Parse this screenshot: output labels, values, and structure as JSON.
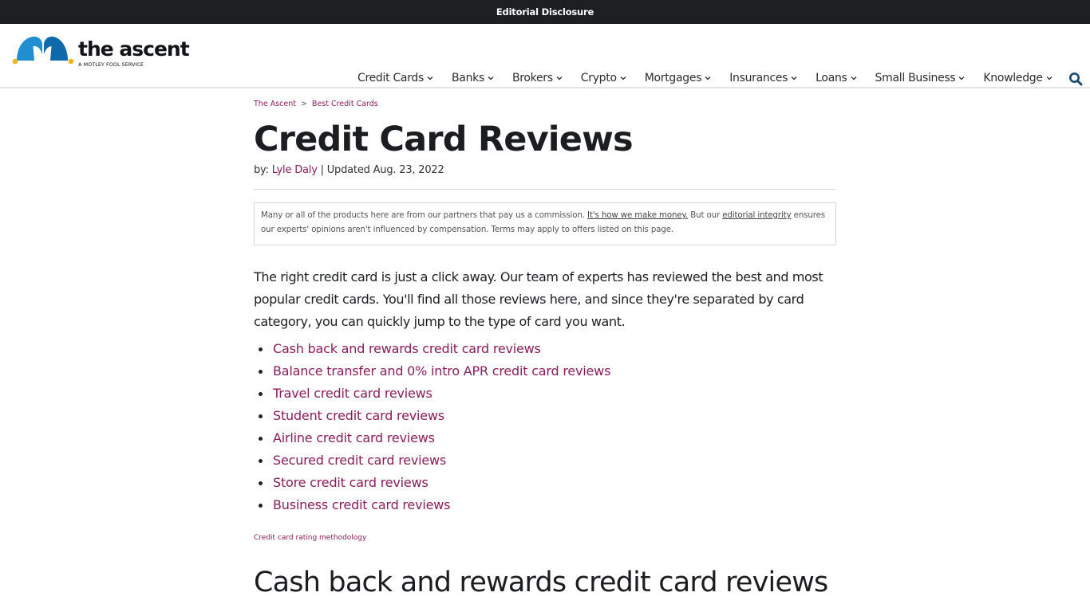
{
  "topbar": {
    "label": "Editorial Disclosure"
  },
  "brand": {
    "name": "the ascent",
    "tagline": "A MOTLEY FOOL SERVICE",
    "colors": {
      "hat_left": "#1f8fd0",
      "hat_right": "#0e6aaa",
      "bells": "#f3b31b",
      "accent": "#8b1c5c",
      "nav_icon": "#1c4a6e"
    }
  },
  "nav": {
    "items": [
      {
        "label": "Credit Cards",
        "icon": "chevron-down-icon"
      },
      {
        "label": "Banks",
        "icon": "chevron-down-icon"
      },
      {
        "label": "Brokers",
        "icon": "chevron-down-icon"
      },
      {
        "label": "Crypto",
        "icon": "chevron-down-icon"
      },
      {
        "label": "Mortgages",
        "icon": "chevron-down-icon"
      },
      {
        "label": "Insurances",
        "icon": "chevron-down-icon"
      },
      {
        "label": "Loans",
        "icon": "chevron-down-icon"
      },
      {
        "label": "Small Business",
        "icon": "chevron-down-icon"
      },
      {
        "label": "Knowledge",
        "icon": "chevron-down-icon"
      }
    ],
    "search_icon": "search-icon"
  },
  "breadcrumb": {
    "items": [
      {
        "label": "The Ascent"
      },
      {
        "label": "Best Credit Cards"
      }
    ],
    "separator": ">"
  },
  "article": {
    "title": "Credit Card Reviews",
    "byline_prefix": "by: ",
    "author": "Lyle Daly",
    "updated": " | Updated Aug. 23, 2022",
    "disclosure": {
      "text1": "Many or all of the products here are from our partners that pay us a commission. ",
      "link1": "It's how we make money.",
      "text2": " But our ",
      "link2": "editorial integrity",
      "text3": " ensures our experts' opinions aren't influenced by compensation. Terms may apply to offers listed on this page."
    },
    "intro": "The right credit card is just a click away. Our team of experts has reviewed the best and most popular credit cards. You'll find all those reviews here, and since they're separated by card category, you can quickly jump to the type of card you want.",
    "toc": [
      "Cash back and rewards credit card reviews",
      "Balance transfer and 0% intro APR credit card reviews",
      "Travel credit card reviews",
      "Student credit card reviews",
      "Airline credit card reviews",
      "Secured credit card reviews",
      "Store credit card reviews",
      "Business credit card reviews"
    ],
    "methodology_link": "Credit card rating methodology",
    "section_heading": "Cash back and rewards credit card reviews"
  }
}
